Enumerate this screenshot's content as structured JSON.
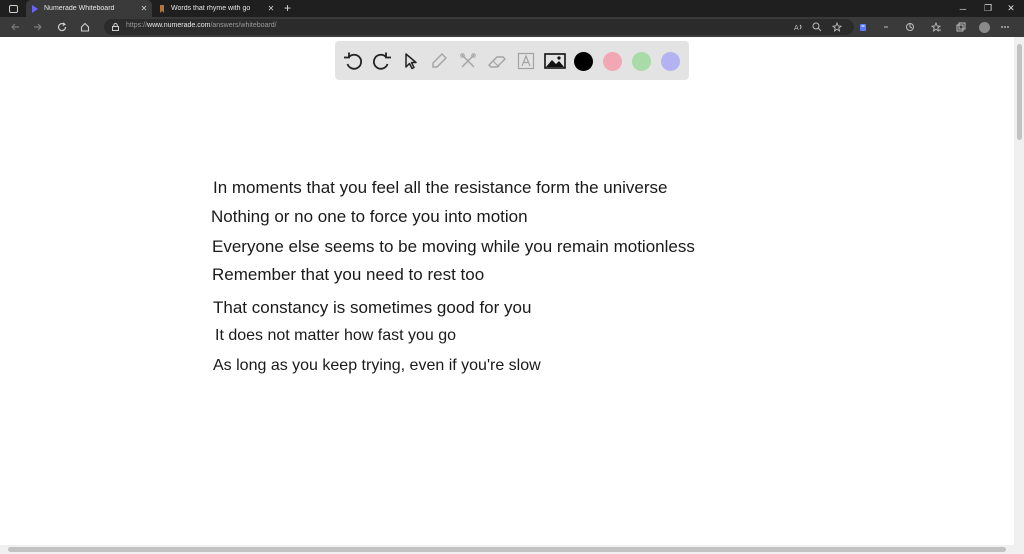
{
  "browser": {
    "tabs": [
      {
        "title": "Numerade Whiteboard",
        "active": true,
        "favicon": "numerade-play-icon"
      },
      {
        "title": "Words that rhyme with go",
        "active": false,
        "favicon": "bookmark-icon"
      }
    ],
    "url": {
      "scheme": "https://",
      "host": "www.numerade.com",
      "path": "/answers/whiteboard/"
    }
  },
  "toolbar": {
    "tools": [
      "undo-icon",
      "redo-icon",
      "select-icon",
      "pen-icon",
      "tools-icon",
      "eraser-icon",
      "text-icon",
      "image-icon"
    ],
    "colors": [
      "#000000",
      "#f2a8b4",
      "#a8dba8",
      "#b3b3f2"
    ],
    "selected_color": "#000000"
  },
  "whiteboard": {
    "lines": [
      "In moments that you feel all the resistance form the universe",
      "Nothing or no one to force you into motion",
      "Everyone else seems to be moving while you remain motionless",
      "Remember that you need to rest too",
      "That constancy is sometimes good for you",
      "It does not matter how fast you go",
      "As long as you keep trying, even if you're slow"
    ]
  }
}
